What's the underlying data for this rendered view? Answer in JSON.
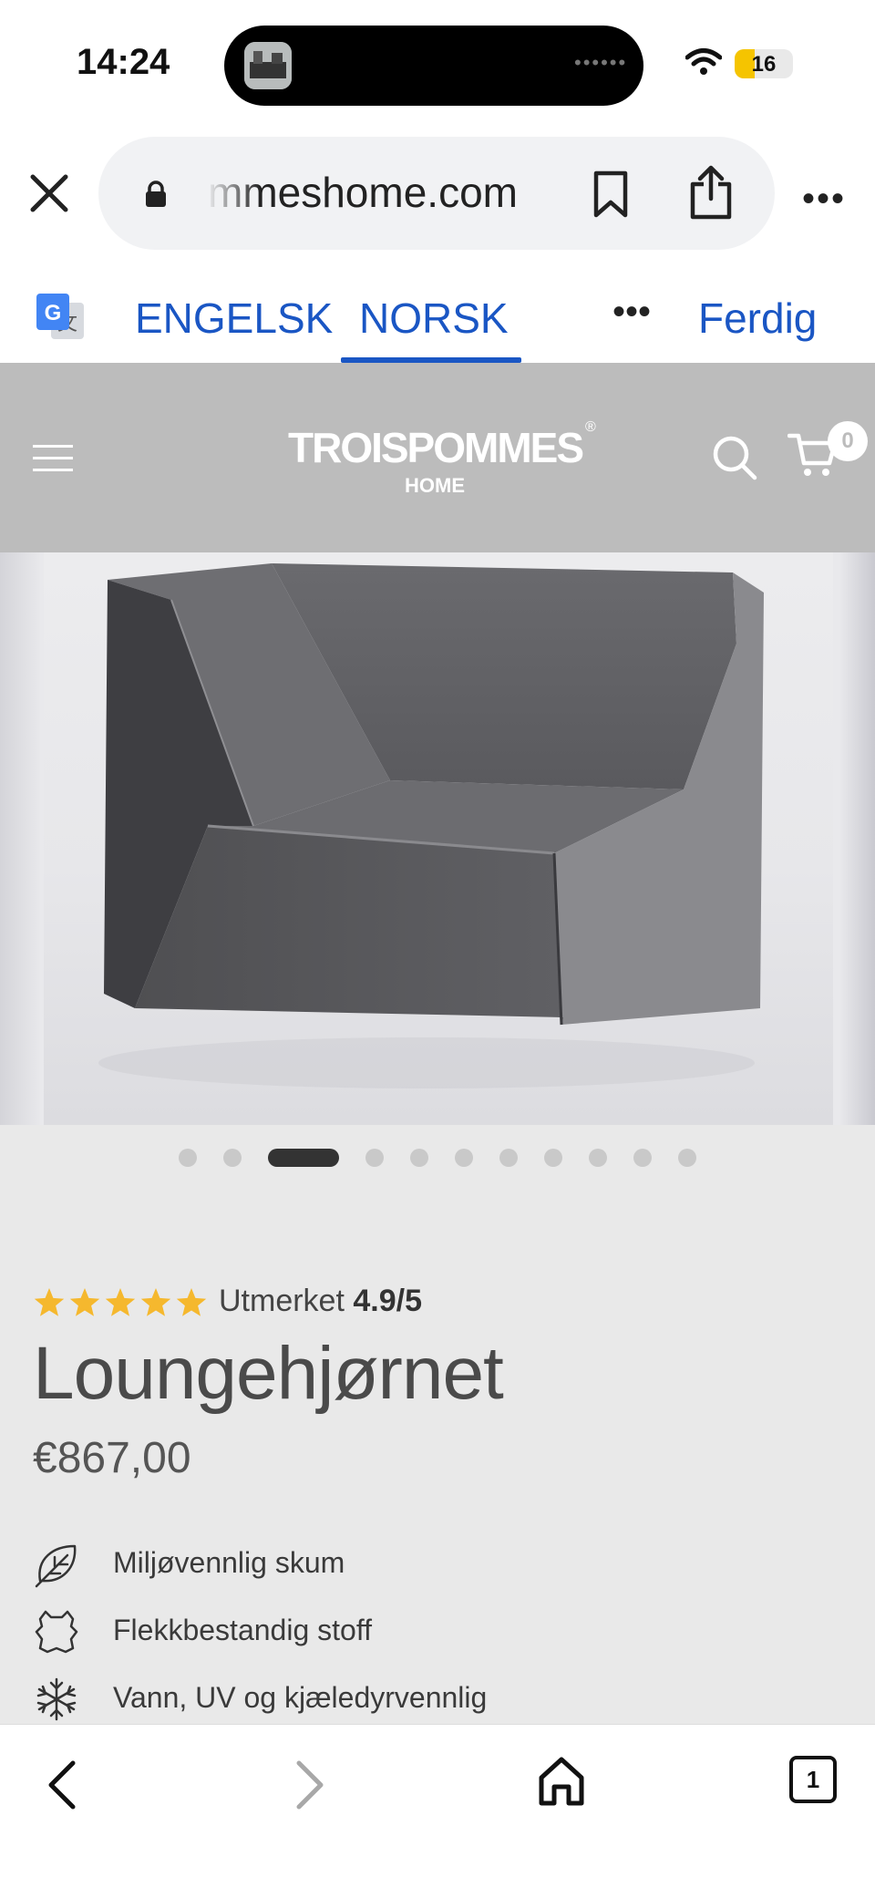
{
  "status_bar": {
    "time": "14:24",
    "battery": "16",
    "dynamic_island_icon": "music-app-thumbnail",
    "dynamic_island_indicator": "••••••"
  },
  "browser": {
    "url": "mmeshome.com",
    "close_icon": "close-icon",
    "lock_icon": "lock-icon",
    "bookmark_icon": "bookmark-icon",
    "share_icon": "share-icon",
    "more_label": "•••"
  },
  "translate_bar": {
    "source_language": "ENGELSK",
    "target_language": "NORSK",
    "selected": "NORSK",
    "more_label": "•••",
    "done_label": "Ferdig",
    "accent_color": "#1a56c4"
  },
  "site_header": {
    "logo_main": "TROISPOMMES",
    "logo_registered": "®",
    "logo_sub": "HOME",
    "cart_count": "0",
    "background_color": "#bcbcbc"
  },
  "gallery": {
    "slide_count": 11,
    "active_index": 2
  },
  "product": {
    "rating_stars": 5,
    "rating_label": "Utmerket",
    "rating_score": "4.9/5",
    "star_color": "#f5b82e",
    "title": "Loungehjørnet",
    "price": "€867,00",
    "features": [
      {
        "icon": "leaf-icon",
        "label": "Miljøvennlig skum"
      },
      {
        "icon": "leather-icon",
        "label": "Flekkbestandig stoff"
      },
      {
        "icon": "snowflake-icon",
        "label": "Vann, UV og kjæledyrvennlig"
      }
    ]
  },
  "bottom_nav": {
    "back_icon": "back-arrow-icon",
    "forward_icon": "forward-arrow-icon",
    "home_icon": "home-icon",
    "tabs_count": "1"
  }
}
